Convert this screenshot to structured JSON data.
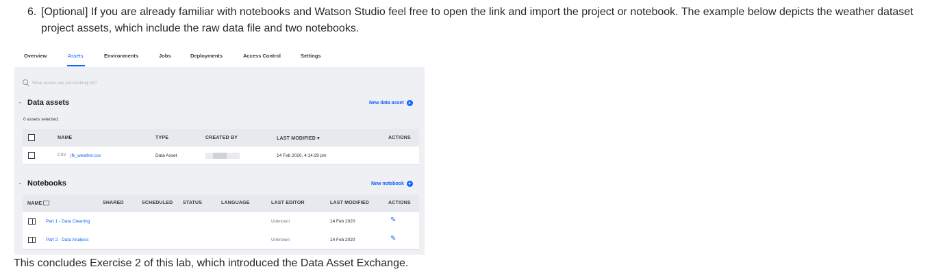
{
  "instructions": {
    "step_number": "6.",
    "step_text_line1": "[Optional] If you are already familiar with notebooks and Watson Studio feel free to open the link and import the project or notebook. The example below depicts the weather dataset",
    "step_text_line2": "project assets, which include the raw data file and two notebooks.",
    "conclusion": "This concludes Exercise 2 of this lab, which introduced the Data Asset Exchange."
  },
  "project": {
    "tabs": [
      {
        "label": "Overview"
      },
      {
        "label": "Assets"
      },
      {
        "label": "Environments"
      },
      {
        "label": "Jobs"
      },
      {
        "label": "Deployments"
      },
      {
        "label": "Access Control"
      },
      {
        "label": "Settings"
      }
    ],
    "active_tab": "Assets",
    "search_placeholder": "What assets are you looking for?",
    "data_assets": {
      "title": "Data assets",
      "new_button": "New data asset",
      "selected_text": "0 assets selected.",
      "columns": {
        "name": "NAME",
        "type": "TYPE",
        "created_by": "CREATED BY",
        "last_modified": "LAST MODIFIED ▾",
        "actions": "ACTIONS"
      },
      "rows": [
        {
          "file_type": "CSV",
          "name": "jfk_weather.csv",
          "type": "Data Asset",
          "last_modified": "14 Feb 2020, 4:14:29 pm"
        }
      ]
    },
    "notebooks": {
      "title": "Notebooks",
      "new_button": "New notebook",
      "columns": {
        "name": "NAME",
        "shared": "SHARED",
        "scheduled": "SCHEDULED",
        "status": "STATUS",
        "language": "LANGUAGE",
        "last_editor": "LAST EDITOR",
        "last_modified": "LAST MODIFIED",
        "actions": "ACTIONS"
      },
      "rows": [
        {
          "name": "Part 1 - Data Cleaning",
          "last_editor": "Unknown",
          "last_modified": "14 Feb 2020"
        },
        {
          "name": "Part 2 - Data Analysis",
          "last_editor": "Unknown",
          "last_modified": "14 Feb 2020"
        }
      ]
    },
    "colors": {
      "accent": "#0f62fe",
      "panel": "#eef0f4",
      "header": "#e7e9ee"
    },
    "icons": [
      "search-icon",
      "chevron-down-icon",
      "add-icon",
      "checkbox-icon",
      "notebook-icon",
      "pencil-icon",
      "sort-icon"
    ]
  }
}
